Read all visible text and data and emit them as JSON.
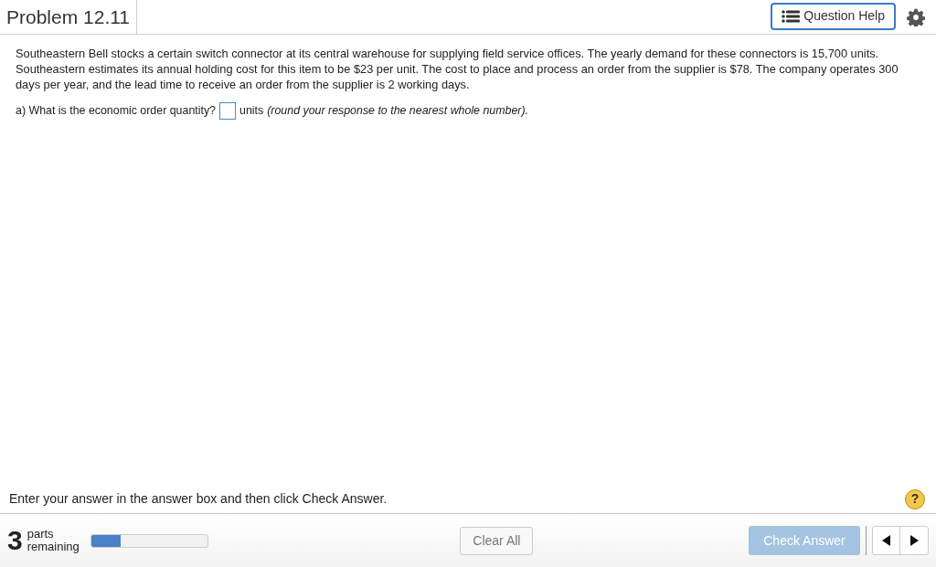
{
  "header": {
    "title": "Problem 12.11",
    "help_button": "Question Help"
  },
  "problem": {
    "text": "Southeastern Bell stocks a certain switch connector at its central warehouse for supplying field service offices. The yearly demand for these connectors is 15,700 units. Southeastern estimates its annual holding cost for this item to be $23 per unit. The cost to place and process an order from the supplier is $78. The company operates 300 days per year, and the lead time to receive an order from the supplier is 2 working days.",
    "question": {
      "prompt": "a) What is the economic order quantity?",
      "unit": "units",
      "hint": "(round your response to the nearest whole number)."
    }
  },
  "instruction": "Enter your answer in the answer box and then click Check Answer.",
  "help_icon": "?",
  "footer": {
    "parts_count": "3",
    "parts_label_1": "parts",
    "parts_label_2": "remaining",
    "progress": {
      "level": 0.25
    },
    "clear_button": "Clear All",
    "check_button": {
      "label": "Check Answer",
      "disabled": true
    }
  }
}
